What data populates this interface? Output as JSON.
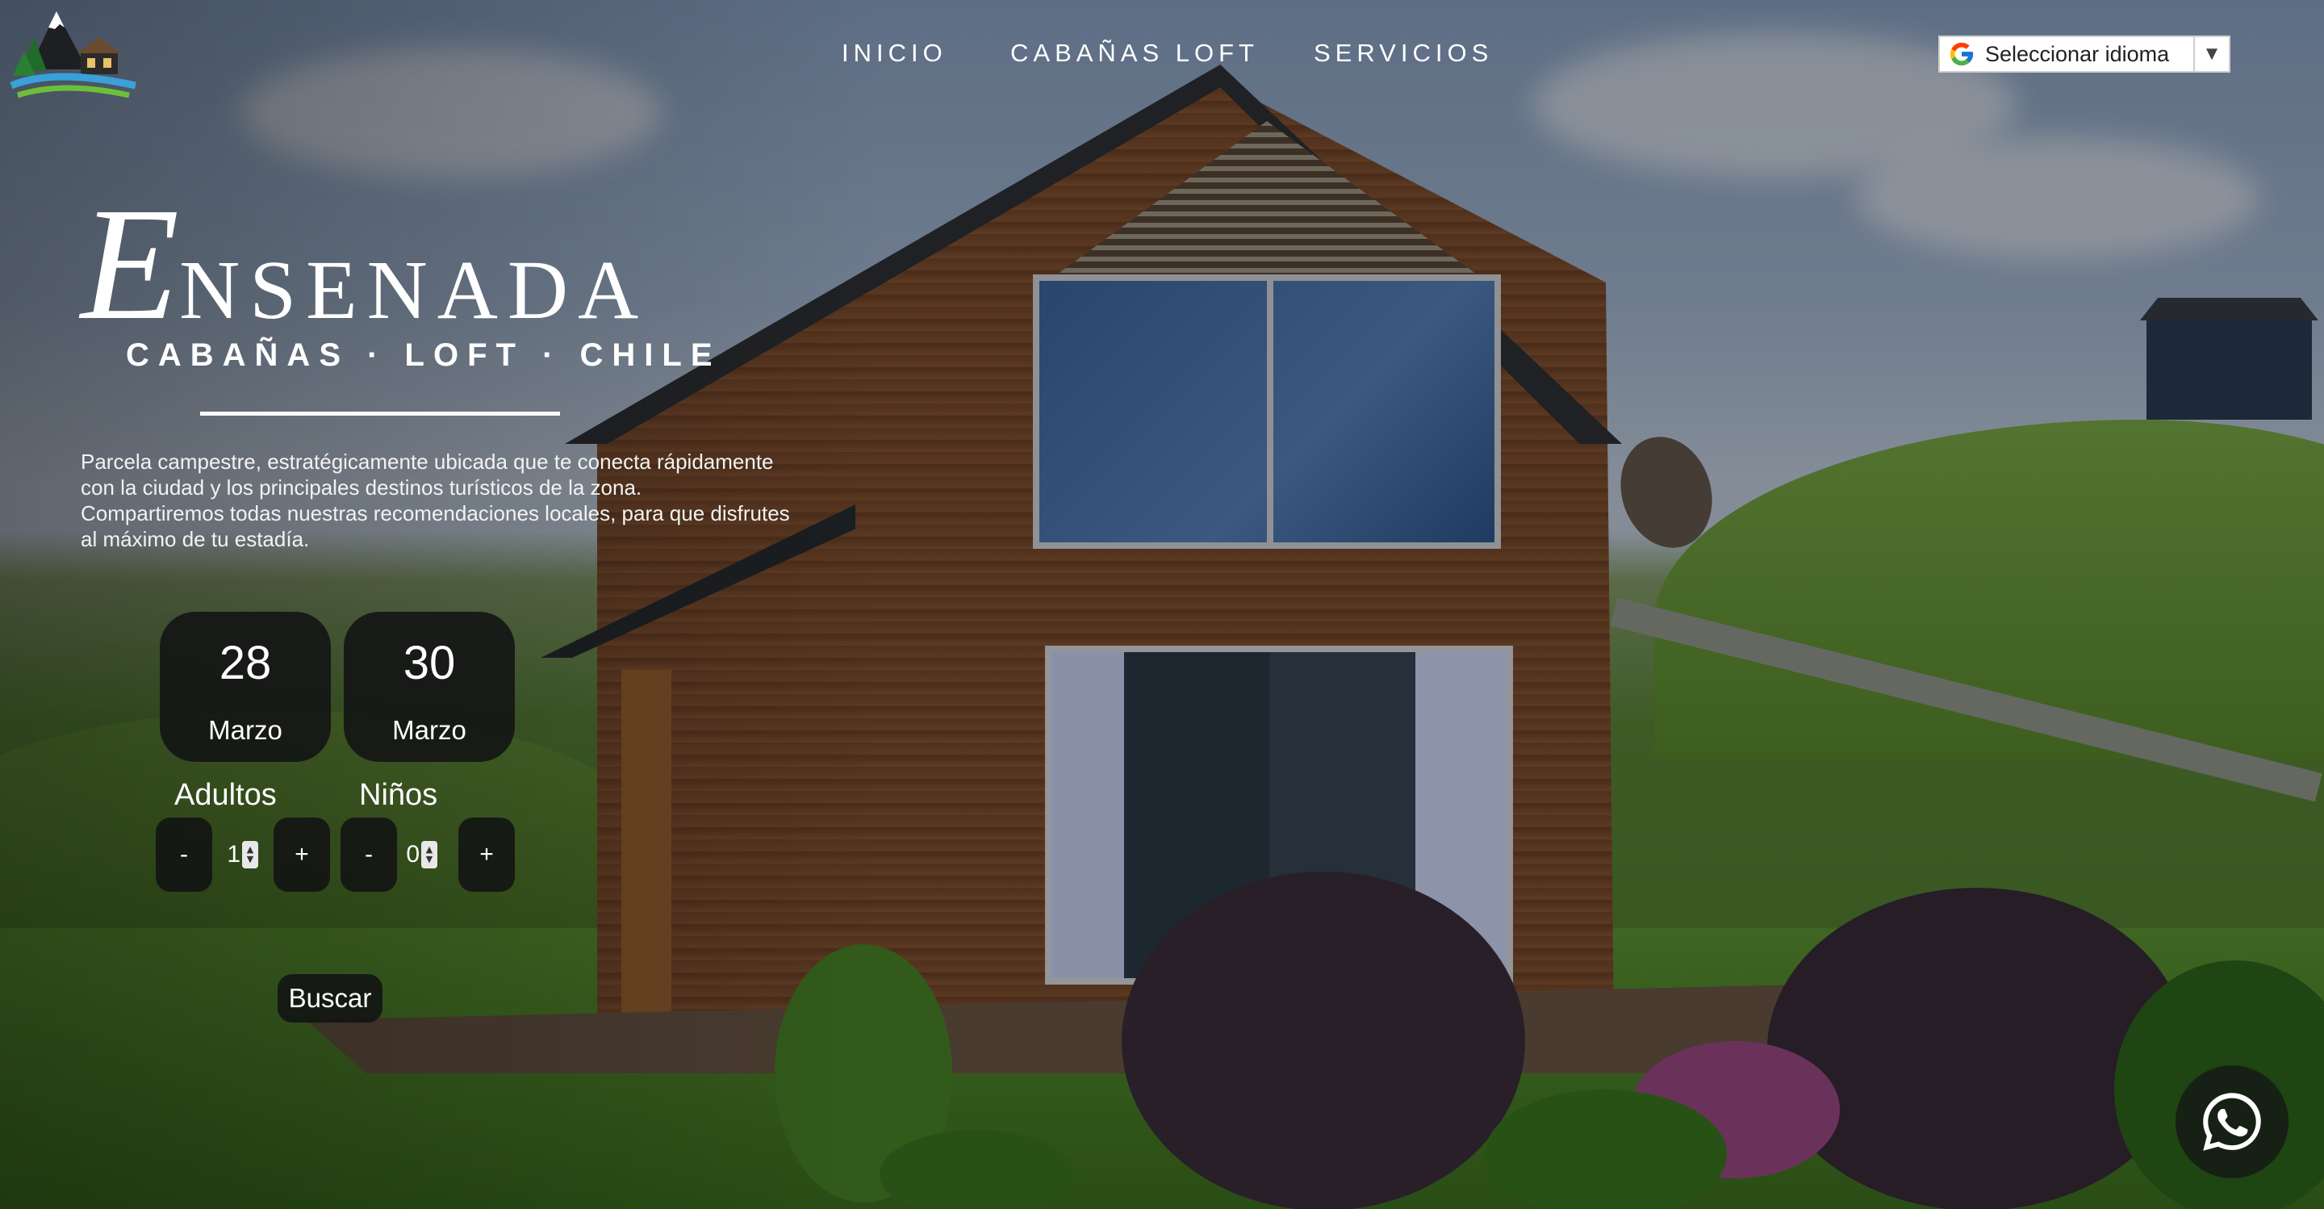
{
  "header": {
    "logo": "ensenada-logo",
    "nav": [
      {
        "label": "INICIO"
      },
      {
        "label": "CABAÑAS LOFT"
      },
      {
        "label": "SERVICIOS"
      }
    ],
    "language_select": {
      "label": "Seleccionar idioma",
      "icon": "google-g-icon"
    }
  },
  "hero": {
    "title_initial": "E",
    "title_rest": "NSENADA",
    "subtitle": "CABAÑAS · LOFT · CHILE",
    "description": "Parcela campestre, estratégicamente ubicada que te conecta rápidamente con la ciudad y los principales destinos turísticos de la zona. Compartiremos todas nuestras recomendaciones locales, para que disfrutes al máximo de tu estadía."
  },
  "booking": {
    "checkin": {
      "day": "28",
      "month": "Marzo"
    },
    "checkout": {
      "day": "30",
      "month": "Marzo"
    },
    "adults": {
      "label": "Adultos",
      "value": "1",
      "minus": "-",
      "plus": "+"
    },
    "children": {
      "label": "Niños",
      "value": "0",
      "minus": "-",
      "plus": "+"
    },
    "search_label": "Buscar"
  },
  "floating": {
    "whatsapp_icon": "whatsapp-icon"
  }
}
